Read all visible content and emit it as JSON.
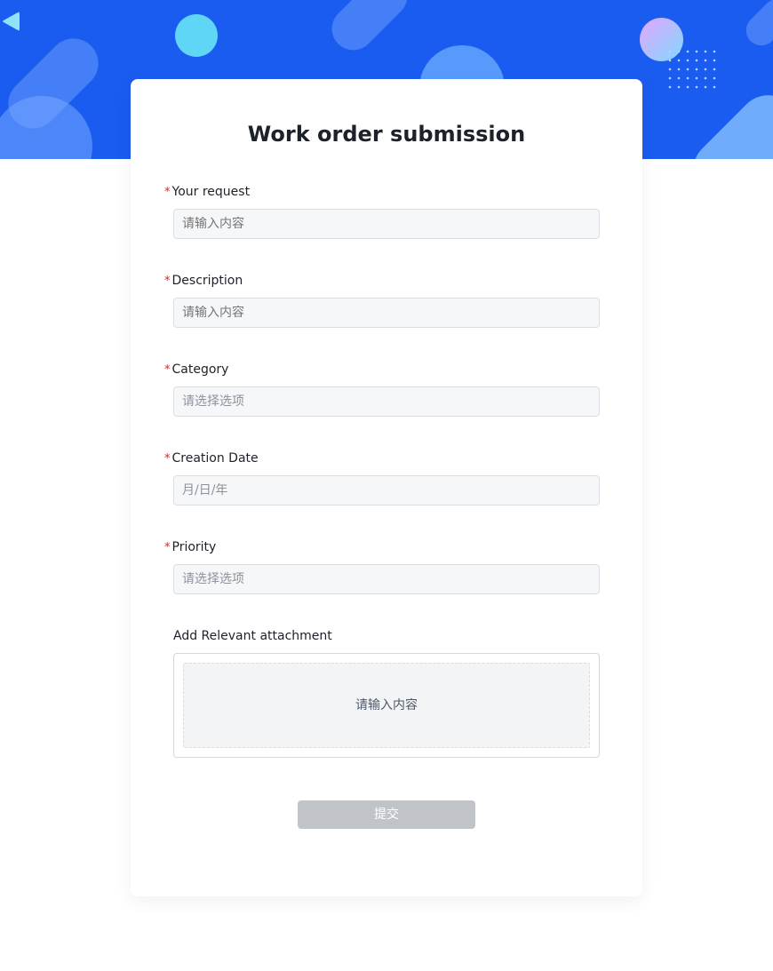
{
  "colors": {
    "banner": "#1a5cf0",
    "required_mark": "#c53030",
    "submit_disabled": "#c0c3c8"
  },
  "icons": {
    "back": "back-arrow-icon"
  },
  "form": {
    "title": "Work order submission",
    "required_mark": "*",
    "fields": [
      {
        "label": "Your request",
        "required": true,
        "placeholder": "请输入内容",
        "type": "text"
      },
      {
        "label": "Description",
        "required": true,
        "placeholder": "请输入内容",
        "type": "text"
      },
      {
        "label": "Category",
        "required": true,
        "placeholder": "请选择选项",
        "type": "select"
      },
      {
        "label": "Creation Date",
        "required": true,
        "placeholder": "月/日/年",
        "type": "date"
      },
      {
        "label": "Priority",
        "required": true,
        "placeholder": "请选择选项",
        "type": "select"
      }
    ],
    "attachment": {
      "label": "Add Relevant attachment",
      "placeholder": "请输入内容"
    },
    "submit_label": "提交"
  }
}
